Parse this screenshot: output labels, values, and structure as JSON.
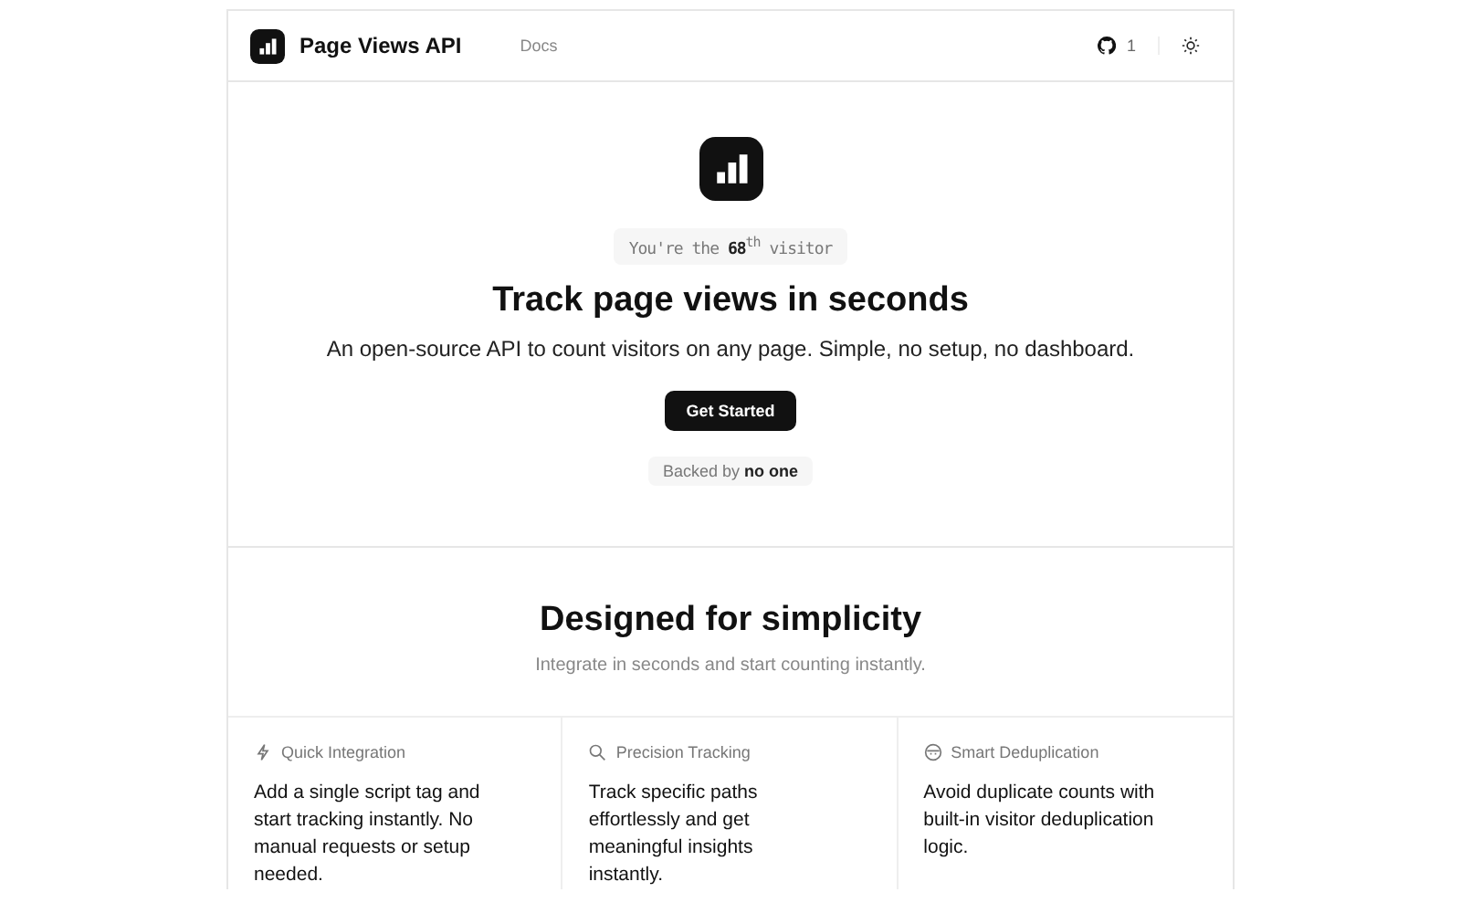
{
  "header": {
    "brand": "Page Views API",
    "nav": [
      {
        "label": "Docs"
      }
    ],
    "github_count": "1"
  },
  "hero": {
    "visitor_badge": "You're the **68**$^{th}$ visitor",
    "title": "Track page views in seconds",
    "subtitle": "An open-source API to count visitors on any page. Simple, no setup, no dashboard.",
    "cta": "Get Started",
    "backed_by": "Backed by **no one**"
  },
  "features": {
    "title": "Designed for simplicity",
    "subtitle": "Integrate in seconds and start counting instantly.",
    "items": [
      {
        "kind": "bolt",
        "title": "Quick Integration",
        "text": "Add a single script tag and start tracking instantly. No manual requests or setup needed."
      },
      {
        "kind": "search",
        "title": "Precision Tracking",
        "text": "Track specific paths effortlessly and get meaningful insights instantly."
      },
      {
        "kind": "mask",
        "title": "Smart Deduplication",
        "text": "Avoid duplicate counts with built-in visitor deduplication logic."
      }
    ]
  }
}
